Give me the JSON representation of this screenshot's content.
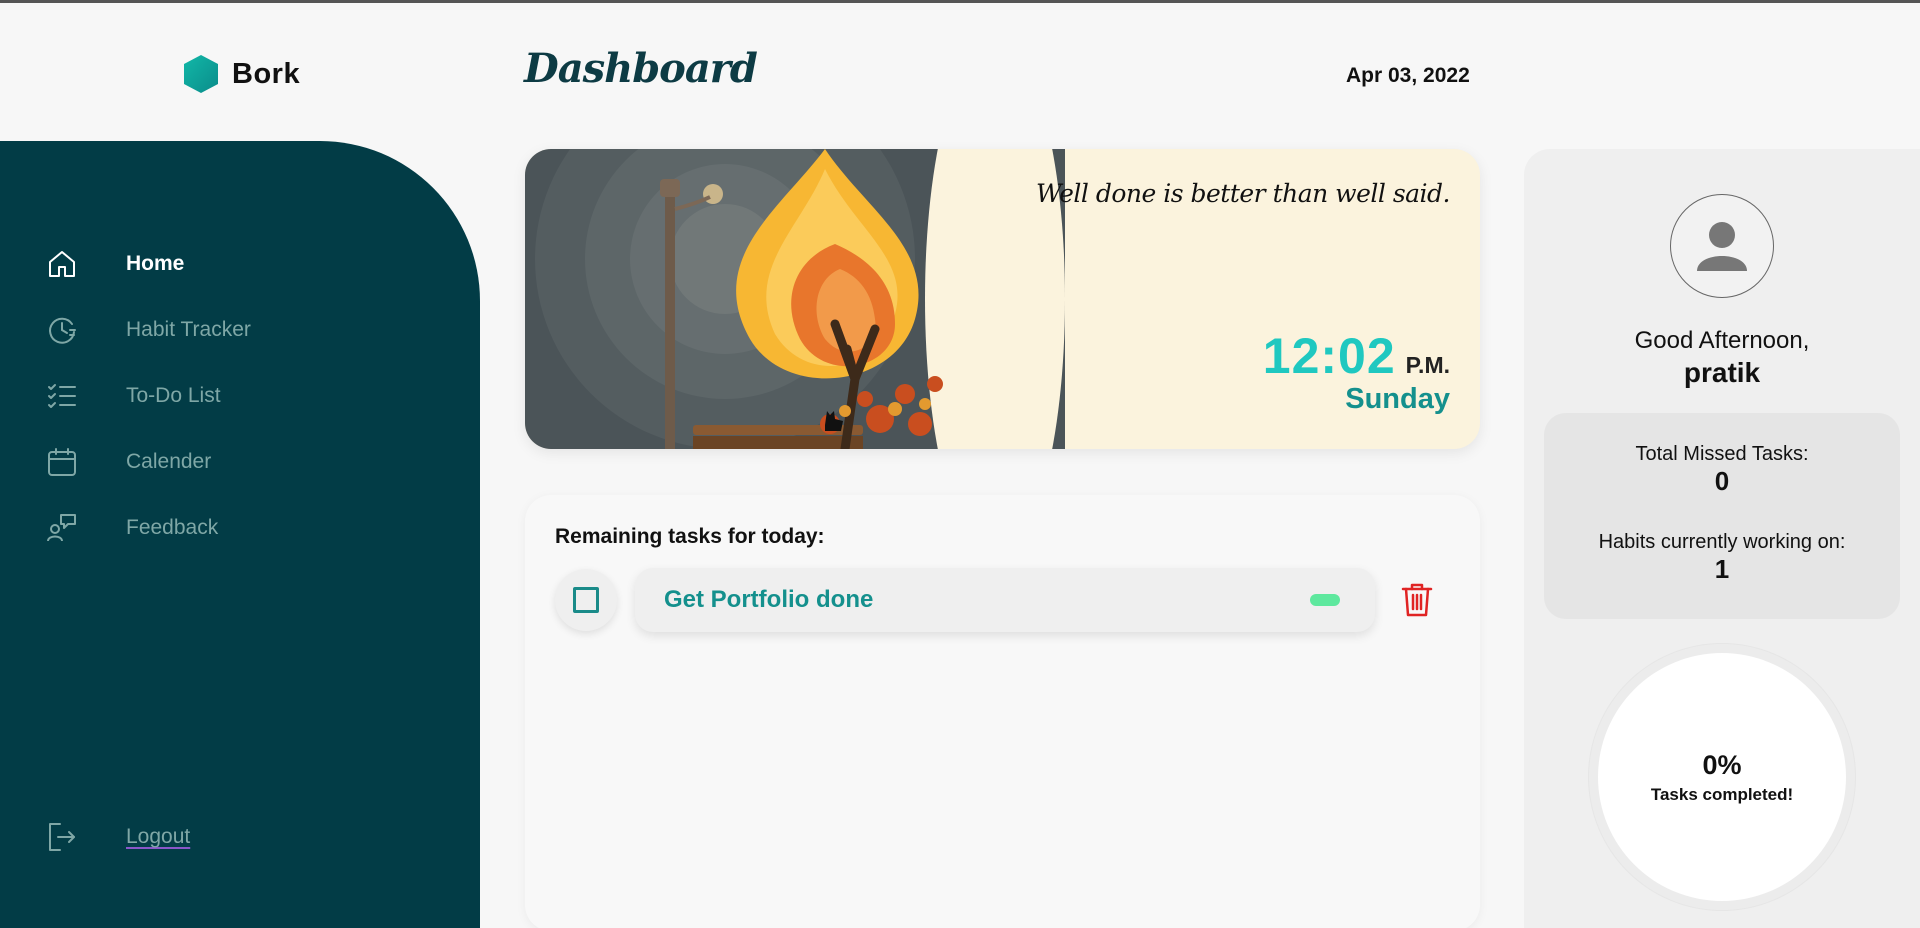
{
  "brand": {
    "name": "Bork"
  },
  "header": {
    "title": "Dashboard",
    "date": "Apr 03, 2022"
  },
  "sidebar": {
    "items": [
      {
        "label": "Home",
        "icon": "home-icon",
        "active": true
      },
      {
        "label": "Habit Tracker",
        "icon": "habit-clock-icon",
        "active": false
      },
      {
        "label": "To-Do List",
        "icon": "checklist-icon",
        "active": false
      },
      {
        "label": "Calender",
        "icon": "calendar-icon",
        "active": false
      },
      {
        "label": "Feedback",
        "icon": "feedback-icon",
        "active": false
      }
    ],
    "logout": {
      "label": "Logout",
      "icon": "logout-icon"
    }
  },
  "hero": {
    "quote": "Well done is better than well said.",
    "time": "12:02",
    "ampm": "P.M.",
    "day": "Sunday"
  },
  "tasks": {
    "heading": "Remaining tasks for today:",
    "items": [
      {
        "text": "Get Portfolio done",
        "checked": false,
        "priority_color": "#5ee89e"
      }
    ]
  },
  "profile": {
    "greeting": "Good Afternoon,",
    "username": "pratik",
    "missed_label": "Total Missed Tasks:",
    "missed_value": "0",
    "habits_label": "Habits currently working on:",
    "habits_value": "1",
    "progress_pct": "0%",
    "progress_label": "Tasks completed!"
  },
  "colors": {
    "sidebar_bg": "#023c46",
    "accent_teal": "#14908d",
    "clock_cyan": "#1fc8c0",
    "delete_red": "#e02424"
  }
}
